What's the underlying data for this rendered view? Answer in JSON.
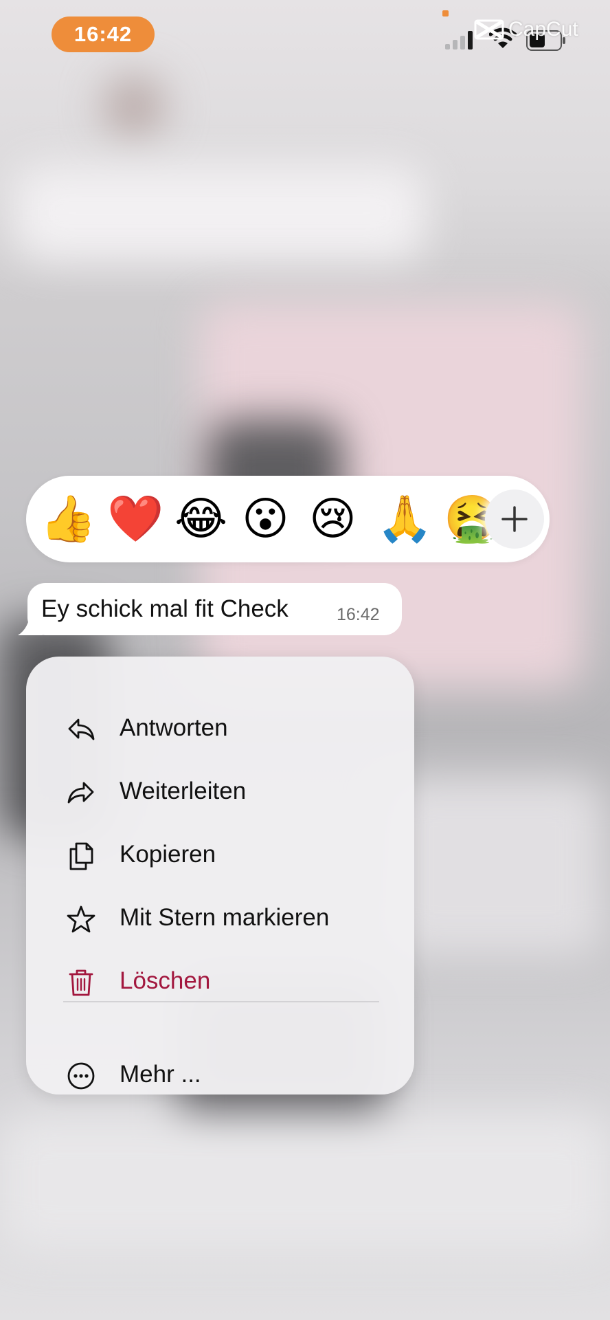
{
  "status_bar": {
    "time": "16:42",
    "watermark": "CapCut",
    "accent_color": "#ee8d3a"
  },
  "reactions": {
    "emojis": [
      {
        "icon": "thumbs-up",
        "glyph": "👍"
      },
      {
        "icon": "red-heart",
        "glyph": "❤️"
      },
      {
        "icon": "tears-of-joy",
        "glyph": "😂"
      },
      {
        "icon": "surprised-face",
        "glyph": "😮"
      },
      {
        "icon": "crying-face",
        "glyph": "😢"
      },
      {
        "icon": "folded-hands",
        "glyph": "🙏"
      },
      {
        "icon": "vomiting-face",
        "glyph": "🤮"
      }
    ],
    "more_icon": "plus-icon"
  },
  "message": {
    "text": "Ey schick mal fit Check",
    "time": "16:42"
  },
  "menu": {
    "items": [
      {
        "label": "Antworten",
        "icon": "reply-icon"
      },
      {
        "label": "Weiterleiten",
        "icon": "forward-icon"
      },
      {
        "label": "Kopieren",
        "icon": "copy-icon"
      },
      {
        "label": "Mit Stern markieren",
        "icon": "star-icon"
      },
      {
        "label": "Löschen",
        "icon": "trash-icon",
        "color": "#a2173e"
      },
      {
        "label": "Mehr ...",
        "icon": "more-icon"
      }
    ]
  }
}
